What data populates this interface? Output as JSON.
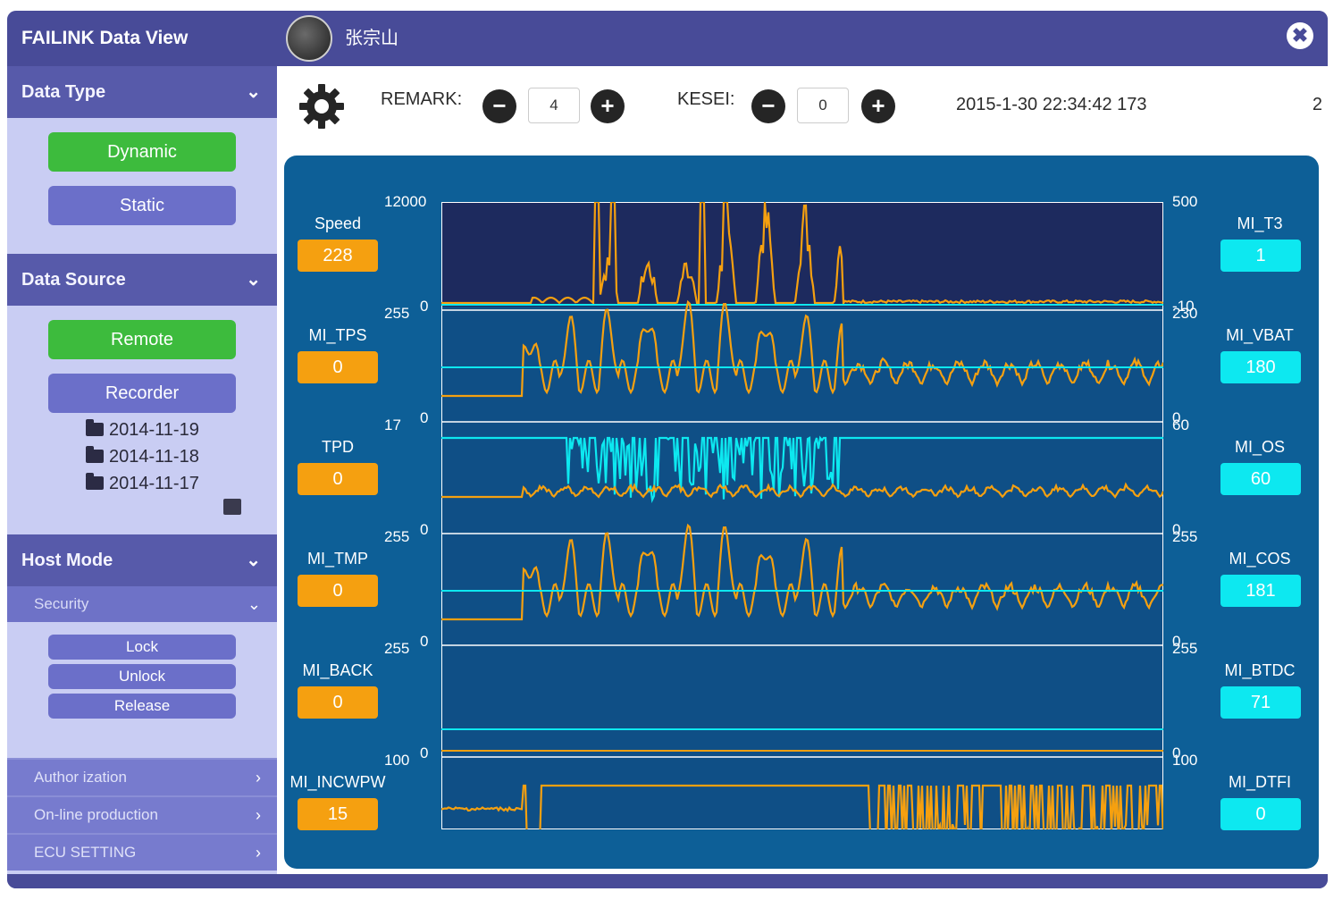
{
  "app": {
    "title": "FAILINK Data View"
  },
  "sidebar": {
    "data_type": {
      "label": "Data Type",
      "buttons": [
        "Dynamic",
        "Static"
      ]
    },
    "data_source": {
      "label": "Data Source",
      "buttons": [
        "Remote",
        "Recorder"
      ],
      "folders": [
        "2014-11-19",
        "2014-11-18",
        "2014-11-17"
      ]
    },
    "host_mode": {
      "label": "Host Mode",
      "security": {
        "label": "Security",
        "buttons": [
          "Lock",
          "Unlock",
          "Release"
        ]
      },
      "items": [
        "Author ization",
        "On-line production",
        "ECU SETTING"
      ]
    }
  },
  "header": {
    "username": "张宗山",
    "close_icon": "close-icon"
  },
  "toolbar": {
    "remark_label": "REMARK:",
    "remark_value": "4",
    "kesei_label": "KESEI:",
    "kesei_value": "0",
    "timestamp": "2015-1-30 22:34:42 173",
    "count": "2"
  },
  "chart_data": {
    "type": "line",
    "colors": {
      "left_series": "#f5a010",
      "right_series": "#0de8f0",
      "panel": "#0d5f97"
    },
    "lanes": [
      {
        "left": {
          "name": "Speed",
          "value": "228",
          "max": "12000",
          "min": "0"
        },
        "right": {
          "name": "MI_T3",
          "value": "1",
          "max": "500",
          "min": "-10"
        }
      },
      {
        "left": {
          "name": "MI_TPS",
          "value": "0",
          "max": "255",
          "min": "0"
        },
        "right": {
          "name": "MI_VBAT",
          "value": "180",
          "max": "230",
          "min": "0"
        }
      },
      {
        "left": {
          "name": "TPD",
          "value": "0",
          "max": "17",
          "min": "0"
        },
        "right": {
          "name": "MI_OS",
          "value": "60",
          "max": "60",
          "min": "0"
        }
      },
      {
        "left": {
          "name": "MI_TMP",
          "value": "0",
          "max": "255",
          "min": "0"
        },
        "right": {
          "name": "MI_COS",
          "value": "181",
          "max": "255",
          "min": "0"
        }
      },
      {
        "left": {
          "name": "MI_BACK",
          "value": "0",
          "max": "255",
          "min": "0"
        },
        "right": {
          "name": "MI_BTDC",
          "value": "71",
          "max": "255",
          "min": "0"
        }
      },
      {
        "left": {
          "name": "MI_INCWPW",
          "value": "15",
          "max": "100",
          "min": ""
        },
        "right": {
          "name": "MI_DTFI",
          "value": "0",
          "max": "100",
          "min": ""
        }
      }
    ]
  }
}
